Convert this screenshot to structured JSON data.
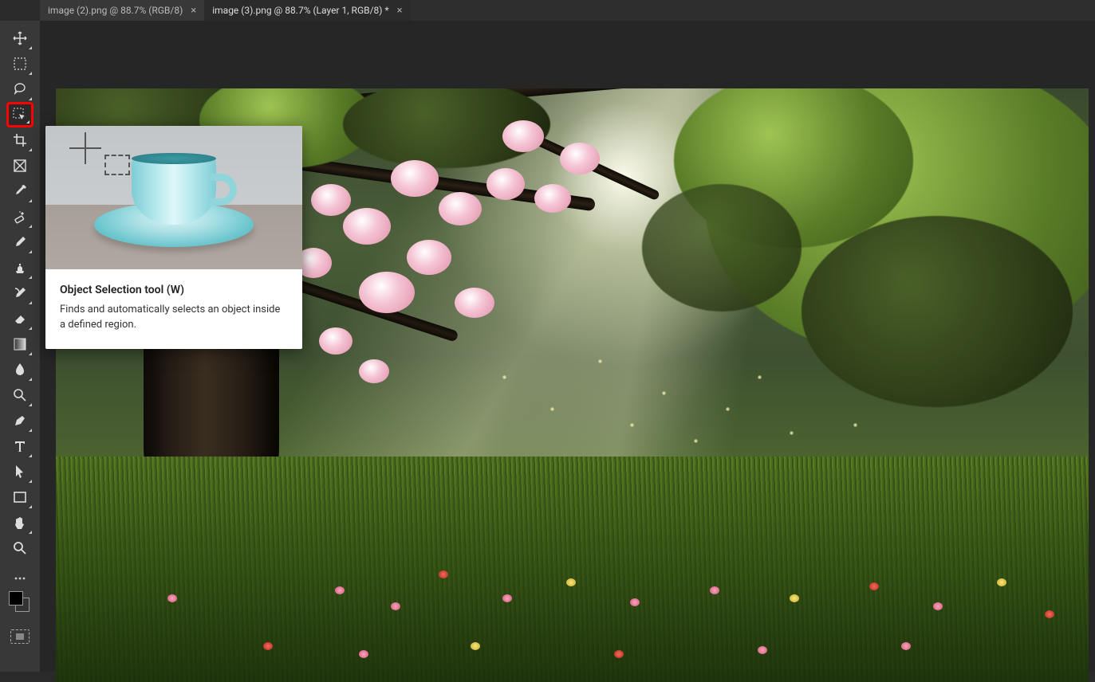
{
  "tabs": [
    {
      "label": "image (2).png @ 88.7% (RGB/8)",
      "active": false
    },
    {
      "label": "image (3).png @ 88.7% (Layer 1, RGB/8) *",
      "active": true
    }
  ],
  "tools": [
    {
      "name": "move-tool",
      "caret": true
    },
    {
      "name": "marquee-tool",
      "caret": true
    },
    {
      "name": "lasso-tool",
      "caret": true
    },
    {
      "name": "object-selection-tool",
      "caret": true,
      "highlighted": true
    },
    {
      "name": "crop-tool",
      "caret": true
    },
    {
      "name": "frame-tool",
      "caret": false
    },
    {
      "name": "eyedropper-tool",
      "caret": true
    },
    {
      "name": "healing-brush-tool",
      "caret": true
    },
    {
      "name": "brush-tool",
      "caret": true
    },
    {
      "name": "clone-stamp-tool",
      "caret": true
    },
    {
      "name": "history-brush-tool",
      "caret": true
    },
    {
      "name": "eraser-tool",
      "caret": true
    },
    {
      "name": "gradient-tool",
      "caret": true
    },
    {
      "name": "blur-tool",
      "caret": true
    },
    {
      "name": "dodge-tool",
      "caret": true
    },
    {
      "name": "pen-tool",
      "caret": true
    },
    {
      "name": "type-tool",
      "caret": true
    },
    {
      "name": "path-selection-tool",
      "caret": true
    },
    {
      "name": "rectangle-tool",
      "caret": true
    },
    {
      "name": "hand-tool",
      "caret": true
    },
    {
      "name": "zoom-tool",
      "caret": false
    }
  ],
  "tooltip": {
    "title": "Object Selection tool (W)",
    "description": "Finds and automatically selects an object inside a defined region."
  },
  "swatch": {
    "foreground": "#000000",
    "background": "#333333"
  }
}
